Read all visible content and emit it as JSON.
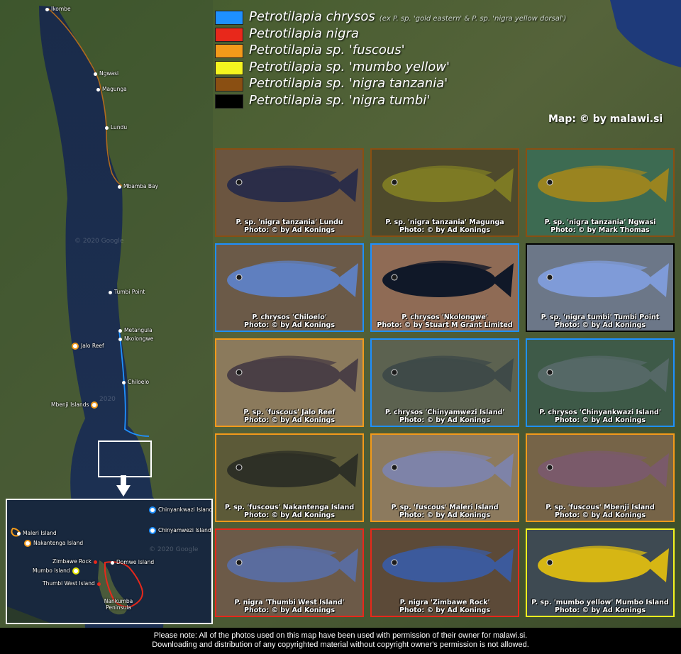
{
  "legend": [
    {
      "color": "#1e90ff",
      "label": "Petrotilapia chrysos",
      "note": "(ex P. sp. 'gold eastern' & P. sp. 'nigra yellow dorsal')"
    },
    {
      "color": "#e8281b",
      "label": "Petrotilapia nigra",
      "note": ""
    },
    {
      "color": "#f39a1a",
      "label": "Petrotilapia sp. 'fuscous'",
      "note": ""
    },
    {
      "color": "#f5f51f",
      "label": "Petrotilapia sp. 'mumbo yellow'",
      "note": ""
    },
    {
      "color": "#8a4f12",
      "label": "Petrotilapia sp. 'nigra tanzania'",
      "note": ""
    },
    {
      "color": "#000000",
      "label": "Petrotilapia sp. 'nigra tumbi'",
      "note": ""
    }
  ],
  "credit": "Map: © by malawi.si",
  "map_watermarks": [
    "© 2020 Google",
    "2020"
  ],
  "locations": [
    {
      "name": "Ikombe",
      "style": "dot"
    },
    {
      "name": "Ngwasi",
      "style": "dot"
    },
    {
      "name": "Magunga",
      "style": "dot"
    },
    {
      "name": "Lundu",
      "style": "dot"
    },
    {
      "name": "Mbamba Bay",
      "style": "dot"
    },
    {
      "name": "Tumbi Point",
      "style": "dot"
    },
    {
      "name": "Metangula",
      "style": "dot"
    },
    {
      "name": "Nkolongwe",
      "style": "dot"
    },
    {
      "name": "Jalo Reef",
      "style": "ring"
    },
    {
      "name": "Chiloelo",
      "style": "dot"
    },
    {
      "name": "Mbenji Islands",
      "style": "ring"
    }
  ],
  "inset": {
    "watermark": "© 2020 Google",
    "locations": [
      {
        "name": "Chinyankwazi Island",
        "style": "ringb"
      },
      {
        "name": "Chinyamwezi Island",
        "style": "ringb"
      },
      {
        "name": "Maleri Island",
        "style": "ring"
      },
      {
        "name": "Nakantenga Island",
        "style": "ring"
      },
      {
        "name": "Zimbawe Rock",
        "style": "dot"
      },
      {
        "name": "Domwe Island",
        "style": "dot"
      },
      {
        "name": "Mumbo Island",
        "style": "ringy"
      },
      {
        "name": "Thumbi West Island",
        "style": "dot"
      },
      {
        "name": "Nankumba Peninsula",
        "style": "plain"
      }
    ]
  },
  "photos": [
    {
      "caption": "P. sp. 'nigra tanzania' Lundu",
      "credit": "Photo: © by Ad Konings",
      "border": "#8a4f12",
      "fish": "#2b2d48",
      "bg": "#6b5540"
    },
    {
      "caption": "P. sp. 'nigra tanzania' Magunga",
      "credit": "Photo: © by Ad Konings",
      "border": "#8a4f12",
      "fish": "#7d7a24",
      "bg": "#4e4a2c"
    },
    {
      "caption": "P. sp. 'nigra tanzania' Ngwasi",
      "credit": "Photo: © by Mark Thomas",
      "border": "#8a4f12",
      "fish": "#9a8420",
      "bg": "#3d6b52"
    },
    {
      "caption": "P. chrysos 'Chiloelo'",
      "credit": "Photo: © by Ad Konings",
      "border": "#1e90ff",
      "fish": "#5f7fbf",
      "bg": "#6b5a48"
    },
    {
      "caption": "P. chrysos 'Nkolongwe'",
      "credit": "Photo: © by Stuart M Grant Limited",
      "border": "#1e90ff",
      "fish": "#101828",
      "bg": "#8f6b55"
    },
    {
      "caption": "P. sp. 'nigra tumbi' Tumbi Point",
      "credit": "Photo: © by Ad Konings",
      "border": "#000000",
      "fish": "#7f9bd8",
      "bg": "#6c7788"
    },
    {
      "caption": "P. sp. 'fuscous' Jalo Reef",
      "credit": "Photo: © by Ad Konings",
      "border": "#f39a1a",
      "fish": "#4a3f45",
      "bg": "#8b7a5c"
    },
    {
      "caption": "P. chrysos 'Chinyamwezi Island'",
      "credit": "Photo: © by Ad Konings",
      "border": "#1e90ff",
      "fish": "#3f4a48",
      "bg": "#5c6250"
    },
    {
      "caption": "P. chrysos 'Chinyankwazi Island'",
      "credit": "Photo: © by Ad Konings",
      "border": "#1e90ff",
      "fish": "#556866",
      "bg": "#3e5a48"
    },
    {
      "caption": "P. sp. 'fuscous' Nakantenga Island",
      "credit": "Photo: © by Ad Konings",
      "border": "#f39a1a",
      "fish": "#2e3026",
      "bg": "#5c5a38"
    },
    {
      "caption": "P. sp. 'fuscous' Maleri Island",
      "credit": "Photo: © by Ad Konings",
      "border": "#f39a1a",
      "fish": "#7e83a8",
      "bg": "#8c7a5e"
    },
    {
      "caption": "P. sp. 'fuscous' Mbenji Island",
      "credit": "Photo: © by Ad Konings",
      "border": "#f39a1a",
      "fish": "#7a5a6a",
      "bg": "#766448"
    },
    {
      "caption": "P. nigra 'Thumbi West Island'",
      "credit": "Photo: © by Ad Konings",
      "border": "#e8281b",
      "fish": "#5a6c9e",
      "bg": "#6c5a48"
    },
    {
      "caption": "P. nigra 'Zimbawe Rock'",
      "credit": "Photo: © by Ad Konings",
      "border": "#e8281b",
      "fish": "#3c5a9c",
      "bg": "#5c4a38"
    },
    {
      "caption": "P. sp. 'mumbo yellow' Mumbo Island",
      "credit": "Photo: © by Ad Konings",
      "border": "#f5f51f",
      "fish": "#d6b614",
      "bg": "#3e4a52"
    }
  ],
  "footer": {
    "line1": "Please note: All of the photos used on this map have been used with permission of their owner for malawi.si.",
    "line2": "Downloading and distribution of any copyrighted material without copyright owner's permission is not allowed."
  }
}
